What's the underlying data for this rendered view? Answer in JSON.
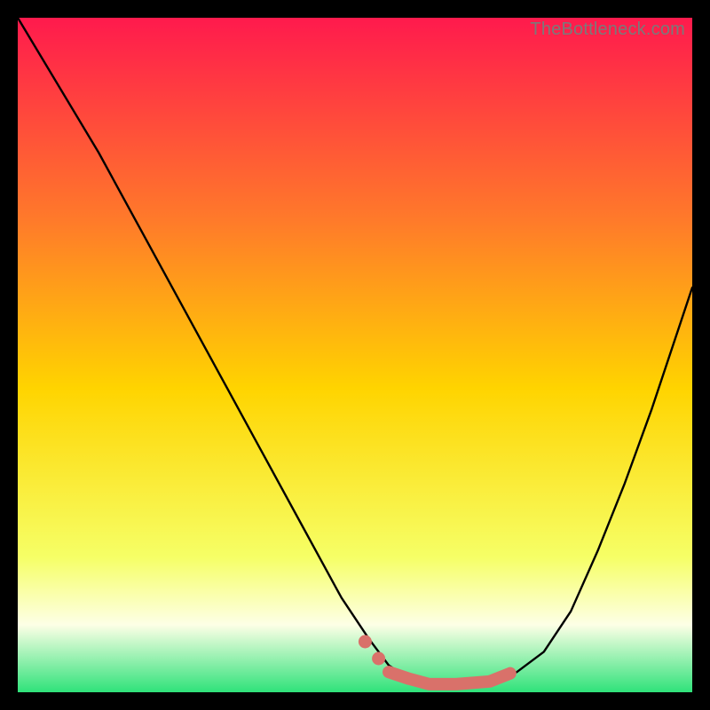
{
  "attribution": "TheBottleneck.com",
  "colors": {
    "background": "#000000",
    "gradient_top": "#ff1a4d",
    "gradient_mid_upper": "#ff7a2a",
    "gradient_mid": "#ffd400",
    "gradient_lower": "#f6ff66",
    "gradient_white": "#fdffe6",
    "gradient_bottom": "#2fe27a",
    "curve": "#000000",
    "accent": "#d9716a"
  },
  "chart_data": {
    "type": "line",
    "title": "",
    "xlabel": "",
    "ylabel": "",
    "ylim": [
      0,
      100
    ],
    "xlim": [
      0,
      100
    ],
    "series": [
      {
        "name": "curve",
        "x": [
          0,
          6,
          12,
          18,
          24,
          30,
          36,
          42,
          48,
          52,
          55,
          58,
          61,
          65,
          70,
          74,
          78,
          82,
          86,
          90,
          94,
          98,
          100
        ],
        "values": [
          100,
          90,
          80,
          69,
          58,
          47,
          36,
          25,
          14,
          8,
          4,
          2,
          1.2,
          1.2,
          1.6,
          3,
          6,
          12,
          21,
          31,
          42,
          54,
          60
        ]
      }
    ],
    "accent_segment": {
      "name": "highlight-flat",
      "x": [
        55,
        58,
        61,
        65,
        70,
        73
      ],
      "values": [
        3.0,
        2.0,
        1.2,
        1.2,
        1.6,
        2.8
      ]
    },
    "accent_dots": [
      {
        "x": 51.5,
        "y": 7.5
      },
      {
        "x": 53.5,
        "y": 5.0
      }
    ]
  }
}
